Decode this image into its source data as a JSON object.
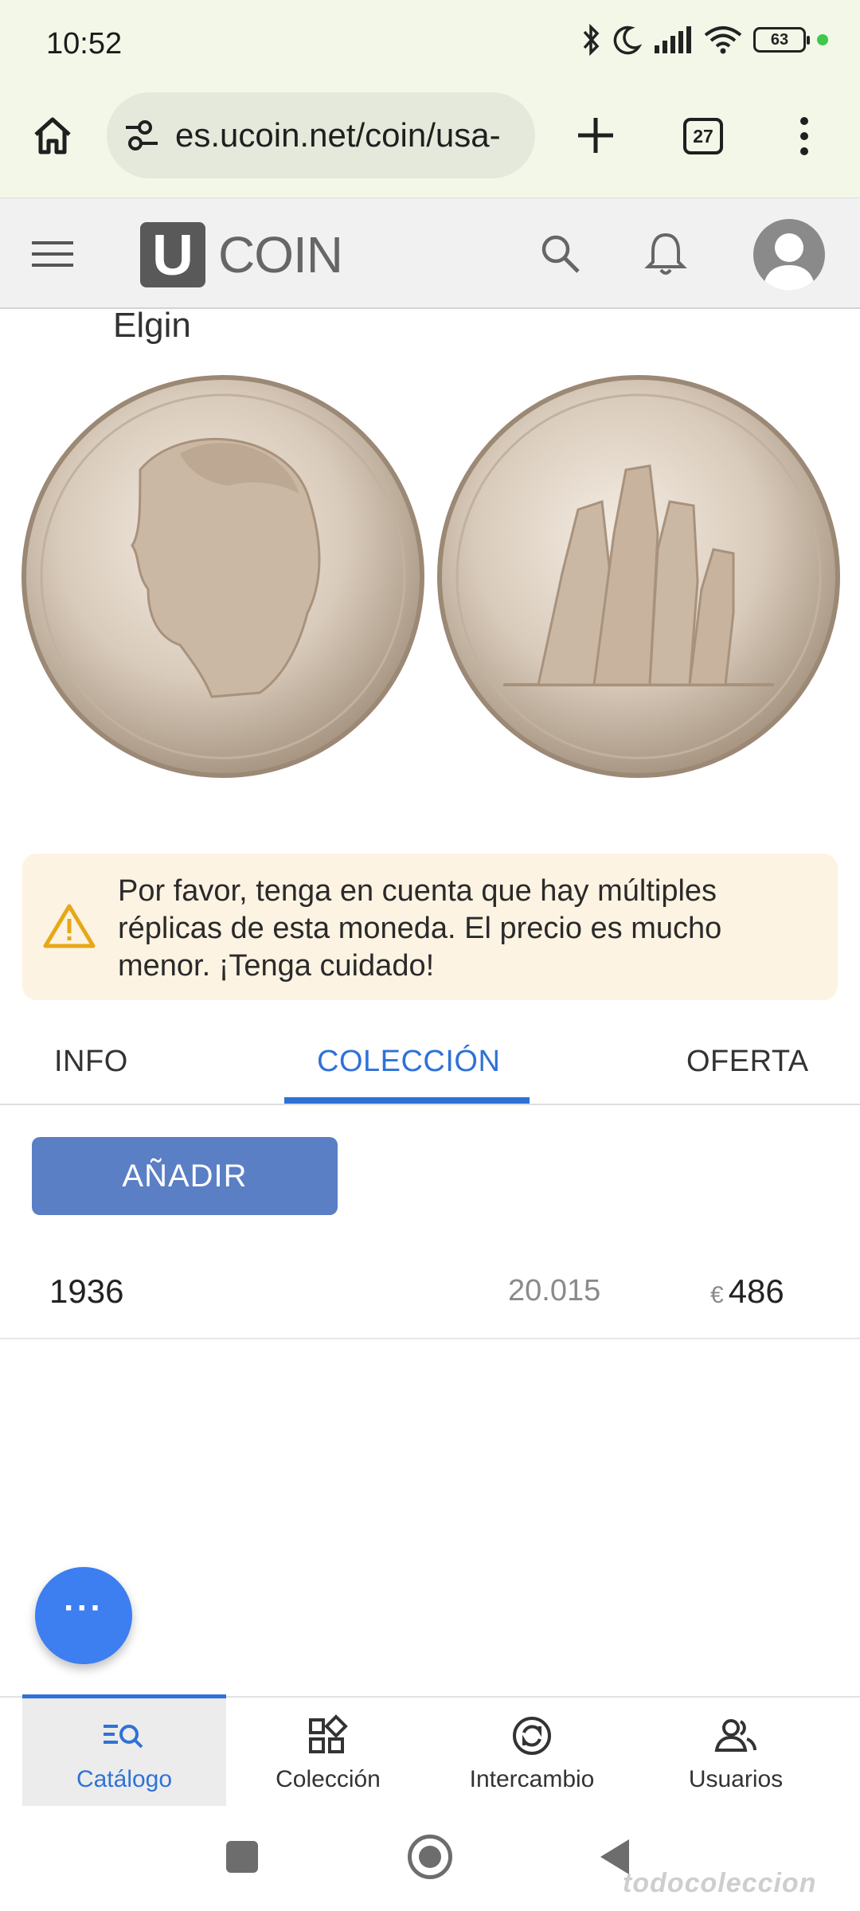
{
  "status_bar": {
    "time": "10:52",
    "battery": "63"
  },
  "browser": {
    "url": "es.ucoin.net/coin/usa-",
    "tab_count": "27"
  },
  "site": {
    "logo_letter": "U",
    "logo_text": "COIN"
  },
  "coin": {
    "title": "Elgin"
  },
  "alert": {
    "message": "Por favor, tenga en cuenta que hay múltiples réplicas de esta moneda. El precio es mucho menor. ¡Tenga cuidado!"
  },
  "tabs": [
    {
      "label": "INFO",
      "active": false
    },
    {
      "label": "COLECCIÓN",
      "active": true
    },
    {
      "label": "OFERTA",
      "active": false
    }
  ],
  "add_button": "AÑADIR",
  "rows": [
    {
      "year": "1936",
      "mintage": "20.015",
      "currency": "€",
      "price": "486"
    }
  ],
  "fab_label": "···",
  "bottom_nav": [
    {
      "label": "Catálogo",
      "icon": "catalog-search-icon",
      "active": true
    },
    {
      "label": "Colección",
      "icon": "collection-grid-icon",
      "active": false
    },
    {
      "label": "Intercambio",
      "icon": "exchange-icon",
      "active": false
    },
    {
      "label": "Usuarios",
      "icon": "users-icon",
      "active": false
    }
  ],
  "watermark": "todocoleccion",
  "colors": {
    "accent": "#2f72d6",
    "button": "#5a7fc5",
    "fab": "#3d7ef0",
    "alert_bg": "#fdf3e3",
    "warning": "#e6a817"
  }
}
